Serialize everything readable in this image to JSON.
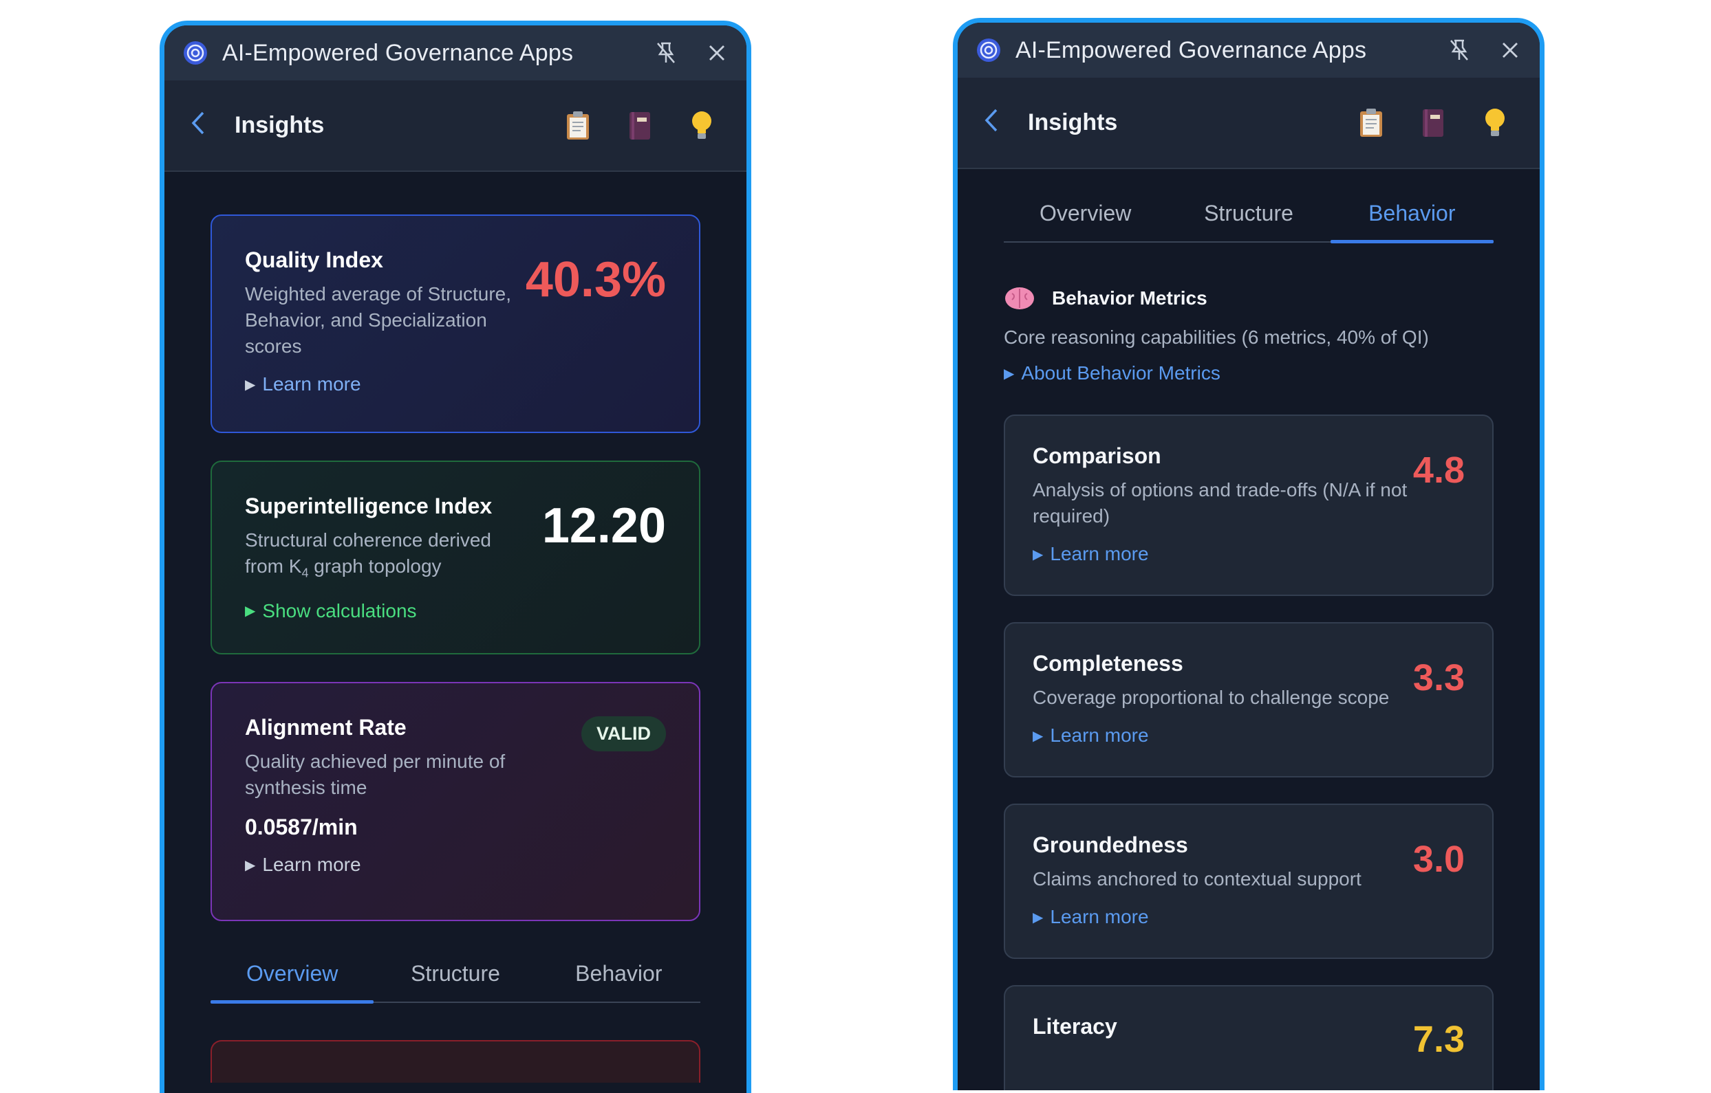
{
  "app_title": "AI-Empowered Governance Apps",
  "header": {
    "title": "Insights"
  },
  "left": {
    "quality": {
      "title": "Quality Index",
      "desc": "Weighted average of Structure, Behavior, and Specialization scores",
      "value": "40.3%",
      "link": "Learn more"
    },
    "superintelligence": {
      "title": "Superintelligence Index",
      "desc_part1": "Structural coherence derived from K",
      "desc_sub": "4",
      "desc_part2": " graph topology",
      "value": "12.20",
      "link": "Show calculations"
    },
    "alignment": {
      "title": "Alignment Rate",
      "desc": "Quality achieved per minute of synthesis time",
      "value": "0.0587/min",
      "badge": "VALID",
      "link": "Learn more"
    },
    "tabs": [
      "Overview",
      "Structure",
      "Behavior"
    ],
    "active_tab": "Overview"
  },
  "right": {
    "tabs": [
      "Overview",
      "Structure",
      "Behavior"
    ],
    "active_tab": "Behavior",
    "section": {
      "title": "Behavior Metrics",
      "subtitle": "Core reasoning capabilities (6 metrics, 40% of QI)",
      "about_link": "About Behavior Metrics"
    },
    "metrics": [
      {
        "title": "Comparison",
        "desc": "Analysis of options and trade-offs (N/A if not required)",
        "value": "4.8",
        "color": "#ee5a5a",
        "link": "Learn more"
      },
      {
        "title": "Completeness",
        "desc": "Coverage proportional to challenge scope",
        "value": "3.3",
        "color": "#ee5a5a",
        "link": "Learn more"
      },
      {
        "title": "Groundedness",
        "desc": "Claims anchored to contextual support",
        "value": "3.0",
        "color": "#ee5a5a",
        "link": "Learn more"
      },
      {
        "title": "Literacy",
        "desc": "",
        "value": "7.3",
        "color": "#f1c232",
        "link": ""
      }
    ]
  },
  "colors": {
    "accent": "#1e9cf3",
    "link_blue": "#5b9bf0",
    "red_value": "#ee5a5a",
    "green_link": "#4ade80",
    "yellow_value": "#f1c232"
  },
  "icons": {
    "logo": "app-logo-icon",
    "pin": "pin-off-icon",
    "close": "close-icon",
    "back": "chevron-left-icon",
    "clipboard": "clipboard-icon",
    "notebook": "notebook-icon",
    "bulb": "lightbulb-icon",
    "brain": "brain-icon"
  }
}
